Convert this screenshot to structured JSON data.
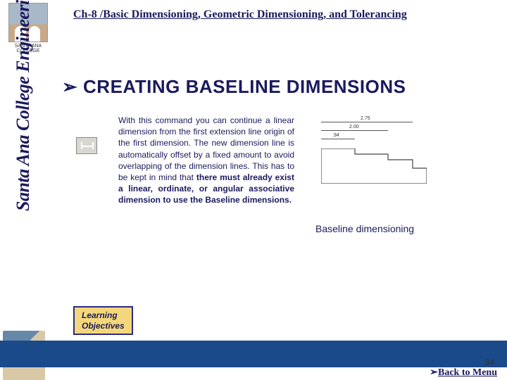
{
  "sidebar": {
    "college_line1": "SANTA ANA",
    "college_line2": "COLLEGE",
    "vertical_text": "Santa Ana College Engineering"
  },
  "header": {
    "chapter_title": "Ch-8 /Basic Dimensioning, Geometric Dimensioning, and Tolerancing"
  },
  "section": {
    "bullet": "➢",
    "heading": "CREATING BASELINE DIMENSIONS"
  },
  "body": {
    "paragraph_plain": "With this command you can continue a linear dimension from the first extension line origin of the first dimension. The new dimension line is automatically offset by a fixed amount to avoid overlapping of the dimension lines. This has to be kept in mind that ",
    "paragraph_bold": "there must already exist a linear, ordinate, or angular associative dimension to use the Baseline dimensions."
  },
  "figure": {
    "dim1": "2.75",
    "dim2": "2.00",
    "dim3": ".94",
    "caption": "Baseline dimensioning"
  },
  "learning": {
    "line1": "Learning",
    "line2": "Objectives"
  },
  "footer": {
    "slide_number": "34",
    "back_arrow": "➢",
    "back_text": "Back to Menu"
  }
}
